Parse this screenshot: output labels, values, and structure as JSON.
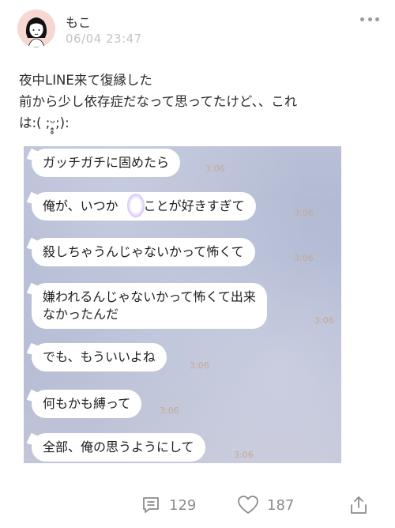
{
  "post": {
    "user_name": "もこ",
    "timestamp": "06/04 23:47",
    "text_lines": [
      "夜中LINE来て復縁した",
      "前から少し依存症だなって思ってたけど、、これ",
      "は:( ;ᵕ̥̥;):"
    ]
  },
  "chat_screenshot": {
    "messages": [
      {
        "text": "ガッチガチに固めたら",
        "time": "3:06"
      },
      {
        "text": "俺が、いつか　のことが好きすぎて",
        "time": "3:06"
      },
      {
        "text": "殺しちゃうんじゃないかって怖くて",
        "time": "3:06"
      },
      {
        "text": "嫌われるんじゃないかって怖くて出来\nなかったんだ",
        "time": "3:06"
      },
      {
        "text": "でも、もういいよね",
        "time": "3:06"
      },
      {
        "text": "何もかも縛って",
        "time": "3:06"
      },
      {
        "text": "全部、俺の思うようにして",
        "time": "3:06"
      }
    ]
  },
  "actions": {
    "comment_count": "129",
    "like_count": "187"
  },
  "icons": {
    "more": "more-horizontal-icon",
    "comment": "comment-icon",
    "like": "heart-icon",
    "share": "share-icon"
  }
}
